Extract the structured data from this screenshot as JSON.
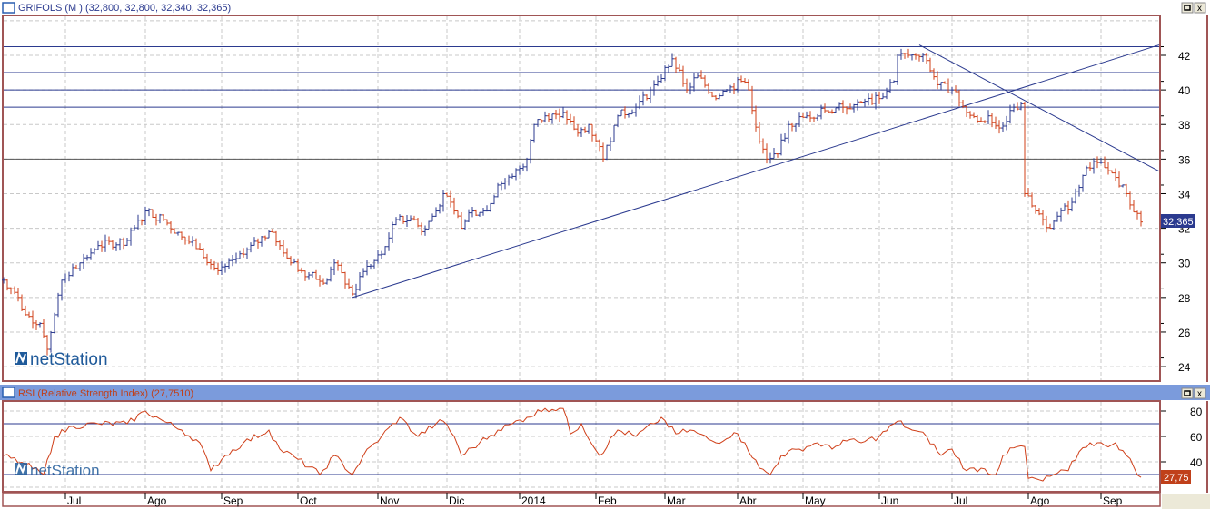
{
  "main_panel": {
    "title": "GRIFOLS (M ) (32,800, 32,800, 32,340, 32,365)",
    "last_price_label": "32,365",
    "watermark": "netStation",
    "maximize_icon": "maximize-icon",
    "close_icon": "close-icon"
  },
  "rsi_panel": {
    "title": "RSI (Relative Strength Index) (27,7510)",
    "last_value_label": "27,75",
    "watermark": "netStation"
  },
  "colors": {
    "up": "#2b3a8f",
    "down": "#d0401a",
    "line": "#2b3a8f",
    "rsi": "#d0401a",
    "frame": "#a05555",
    "rsi_header": "#7b9bdc"
  },
  "chart_data": [
    {
      "type": "ohlc",
      "title": "GRIFOLS (M )",
      "x_unit": "trading day index",
      "ylim": [
        23,
        44
      ],
      "yticks": [
        "24",
        "26",
        "28",
        "30",
        "32",
        "34",
        "36",
        "38",
        "40",
        "42"
      ],
      "xticks": [
        {
          "day": 17,
          "label": "Jul"
        },
        {
          "day": 39,
          "label": "Ago"
        },
        {
          "day": 60,
          "label": "Sep"
        },
        {
          "day": 81,
          "label": "Oct"
        },
        {
          "day": 103,
          "label": "Nov"
        },
        {
          "day": 122,
          "label": "Dic"
        },
        {
          "day": 142,
          "label": "2014"
        },
        {
          "day": 163,
          "label": "Feb"
        },
        {
          "day": 182,
          "label": "Mar"
        },
        {
          "day": 202,
          "label": "Abr"
        },
        {
          "day": 220,
          "label": "May"
        },
        {
          "day": 241,
          "label": "Jun"
        },
        {
          "day": 261,
          "label": "Jul"
        },
        {
          "day": 282,
          "label": "Ago"
        },
        {
          "day": 302,
          "label": "Sep"
        }
      ],
      "closes": [
        [
          0,
          29
        ],
        [
          4,
          28
        ],
        [
          6,
          27
        ],
        [
          10,
          26.5
        ],
        [
          12,
          25
        ],
        [
          14,
          27
        ],
        [
          16,
          29
        ],
        [
          21,
          30
        ],
        [
          26,
          31
        ],
        [
          34,
          31.3
        ],
        [
          39,
          33
        ],
        [
          44,
          32.5
        ],
        [
          49,
          31.5
        ],
        [
          54,
          30.8
        ],
        [
          58,
          29.7
        ],
        [
          61,
          29.8
        ],
        [
          66,
          30.5
        ],
        [
          73,
          31.8
        ],
        [
          76,
          31
        ],
        [
          79,
          30
        ],
        [
          84,
          29.3
        ],
        [
          89,
          29
        ],
        [
          91,
          30
        ],
        [
          96,
          28.2
        ],
        [
          99,
          29.5
        ],
        [
          104,
          30.5
        ],
        [
          108,
          32.5
        ],
        [
          113,
          32.5
        ],
        [
          115,
          31.8
        ],
        [
          119,
          33
        ],
        [
          121,
          34
        ],
        [
          124,
          33
        ],
        [
          126,
          32
        ],
        [
          129,
          33
        ],
        [
          133,
          33
        ],
        [
          136,
          34.5
        ],
        [
          140,
          35
        ],
        [
          144,
          36
        ],
        [
          146,
          38
        ],
        [
          149,
          38.5
        ],
        [
          154,
          38.7
        ],
        [
          158,
          37.5
        ],
        [
          161,
          38
        ],
        [
          165,
          36
        ],
        [
          169,
          38.5
        ],
        [
          174,
          39
        ],
        [
          178,
          40
        ],
        [
          180,
          40.5
        ],
        [
          184,
          41.8
        ],
        [
          188,
          40
        ],
        [
          191,
          40.8
        ],
        [
          196,
          39.5
        ],
        [
          199,
          40
        ],
        [
          203,
          40.5
        ],
        [
          205,
          40
        ],
        [
          208,
          37
        ],
        [
          210,
          36
        ],
        [
          213,
          36.3
        ],
        [
          216,
          38
        ],
        [
          221,
          38.5
        ],
        [
          226,
          38.8
        ],
        [
          231,
          39
        ],
        [
          236,
          39.3
        ],
        [
          241,
          39.5
        ],
        [
          245,
          40.5
        ],
        [
          246,
          42
        ],
        [
          251,
          42
        ],
        [
          254,
          41.7
        ],
        [
          257,
          40.3
        ],
        [
          261,
          40
        ],
        [
          265,
          38.7
        ],
        [
          268,
          38.2
        ],
        [
          271,
          38.5
        ],
        [
          274,
          37.8
        ],
        [
          278,
          39
        ],
        [
          280,
          39.2
        ],
        [
          281,
          34
        ],
        [
          284,
          33
        ],
        [
          286,
          32.5
        ],
        [
          288,
          32
        ],
        [
          290,
          32.7
        ],
        [
          294,
          33.5
        ],
        [
          298,
          35.5
        ],
        [
          301,
          35.8
        ],
        [
          305,
          35.2
        ],
        [
          309,
          34
        ],
        [
          313,
          32.365
        ]
      ],
      "horizontal_lines": [
        42.5,
        41,
        40,
        39,
        36,
        31.9
      ],
      "trend_lines": [
        [
          [
            96,
            28.0
          ],
          [
            318,
            42.6
          ]
        ],
        [
          [
            252,
            42.6
          ],
          [
            318,
            35.3
          ]
        ]
      ],
      "last": 32.365
    },
    {
      "type": "line",
      "title": "RSI (Relative Strength Index)",
      "ylim": [
        18,
        88
      ],
      "yticks": [
        "40",
        "60",
        "80"
      ],
      "levels": [
        70,
        30
      ],
      "values": [
        [
          0,
          45
        ],
        [
          6,
          38
        ],
        [
          11,
          30
        ],
        [
          14,
          60
        ],
        [
          19,
          68
        ],
        [
          26,
          70
        ],
        [
          34,
          70
        ],
        [
          39,
          80
        ],
        [
          44,
          72
        ],
        [
          49,
          65
        ],
        [
          54,
          55
        ],
        [
          57,
          33
        ],
        [
          61,
          45
        ],
        [
          66,
          55
        ],
        [
          73,
          65
        ],
        [
          76,
          50
        ],
        [
          81,
          42
        ],
        [
          87,
          30
        ],
        [
          91,
          45
        ],
        [
          96,
          30
        ],
        [
          99,
          45
        ],
        [
          104,
          60
        ],
        [
          109,
          75
        ],
        [
          114,
          60
        ],
        [
          119,
          70
        ],
        [
          121,
          72
        ],
        [
          124,
          60
        ],
        [
          126,
          45
        ],
        [
          131,
          55
        ],
        [
          136,
          65
        ],
        [
          140,
          70
        ],
        [
          144,
          75
        ],
        [
          149,
          82
        ],
        [
          154,
          82
        ],
        [
          156,
          62
        ],
        [
          159,
          70
        ],
        [
          164,
          45
        ],
        [
          169,
          65
        ],
        [
          174,
          60
        ],
        [
          179,
          70
        ],
        [
          181,
          75
        ],
        [
          185,
          62
        ],
        [
          189,
          65
        ],
        [
          196,
          55
        ],
        [
          201,
          63
        ],
        [
          204,
          55
        ],
        [
          208,
          35
        ],
        [
          211,
          30
        ],
        [
          214,
          45
        ],
        [
          219,
          50
        ],
        [
          224,
          55
        ],
        [
          228,
          50
        ],
        [
          231,
          57
        ],
        [
          236,
          55
        ],
        [
          241,
          60
        ],
        [
          246,
          72
        ],
        [
          250,
          65
        ],
        [
          254,
          60
        ],
        [
          258,
          45
        ],
        [
          261,
          50
        ],
        [
          265,
          33
        ],
        [
          269,
          35
        ],
        [
          273,
          30
        ],
        [
          275,
          45
        ],
        [
          279,
          52
        ],
        [
          281,
          52
        ],
        [
          282,
          27
        ],
        [
          286,
          25
        ],
        [
          289,
          30
        ],
        [
          293,
          33
        ],
        [
          296,
          48
        ],
        [
          299,
          55
        ],
        [
          303,
          53
        ],
        [
          306,
          55
        ],
        [
          309,
          45
        ],
        [
          313,
          27.75
        ]
      ],
      "last": 27.75
    }
  ]
}
